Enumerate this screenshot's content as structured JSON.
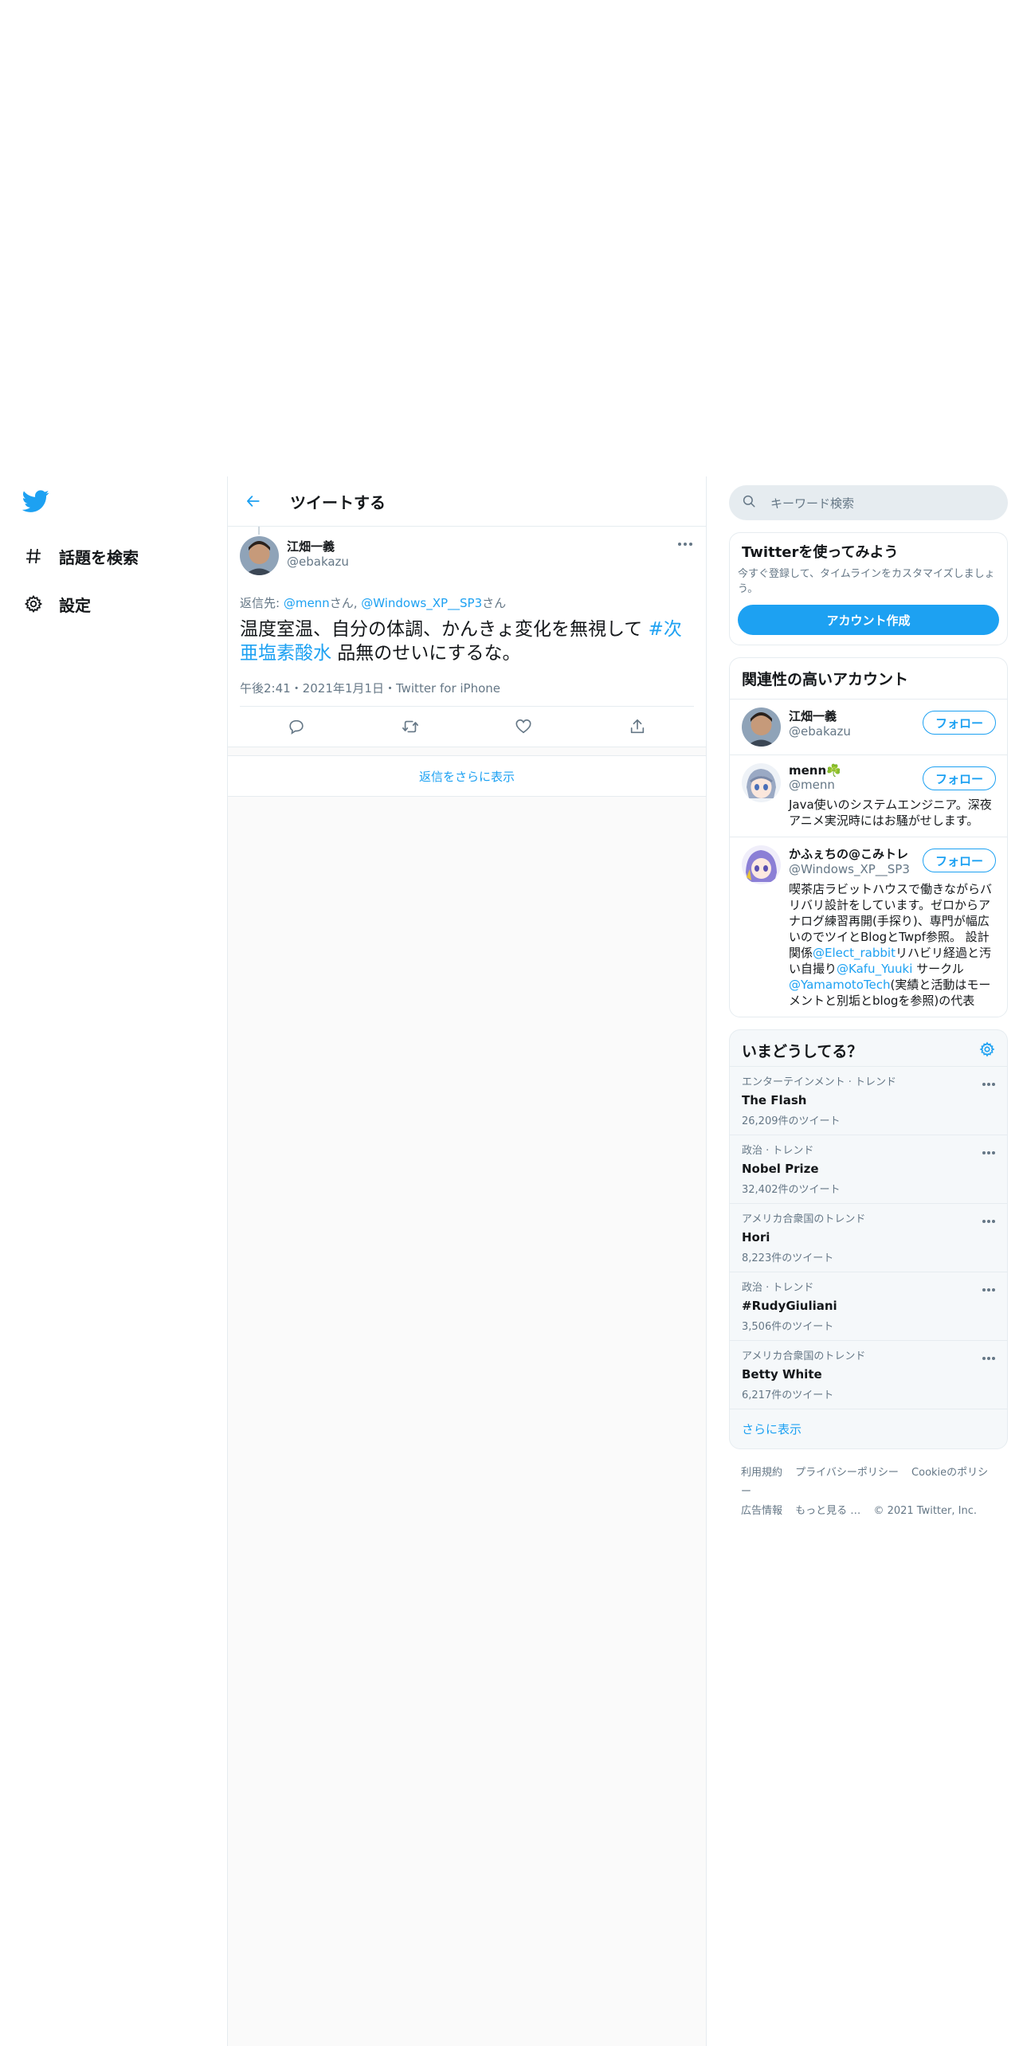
{
  "nav": {
    "items": [
      {
        "label": "話題を検索",
        "icon": "hashtag-icon"
      },
      {
        "label": "設定",
        "icon": "gear-icon"
      }
    ]
  },
  "header": {
    "title": "ツイートする"
  },
  "tweet": {
    "name": "江畑一義",
    "handle": "@ebakazu",
    "reply_prefix": "返信先: ",
    "reply_user1": "@menn",
    "reply_san1": "さん, ",
    "reply_user2": "@Windows_XP__SP3",
    "reply_san2": "さん",
    "text_part1": "温度室温、自分の体調、かんきょ変化を無視して ",
    "hashtag": "#次亜塩素酸水",
    "text_part2": " 品無のせいにするな。",
    "meta": "午後2:41・2021年1月1日・Twitter for iPhone"
  },
  "replies": {
    "show_more": "返信をさらに表示"
  },
  "search": {
    "placeholder": "キーワード検索"
  },
  "promo": {
    "title": "Twitterを使ってみよう",
    "desc": "今すぐ登録して、タイムラインをカスタマイズしましょう。",
    "button": "アカウント作成"
  },
  "related": {
    "title": "関連性の高いアカウント",
    "follow_label": "フォロー",
    "accounts": [
      {
        "name": "江畑一義",
        "handle": "@ebakazu",
        "bio": ""
      },
      {
        "name": "menn☘️",
        "handle": "@menn",
        "bio": "Java使いのシステムエンジニア。深夜アニメ実況時にはお騒がせします。"
      },
      {
        "name": "かふぇちの@こみトレ",
        "handle": "@Windows_XP__SP3",
        "bio_parts": [
          "喫茶店ラビットハウスで働きながらバリバリ設計をしています。ゼロからアナログ練習再開(手探り)、専門が幅広いのでツイとBlogとTwpf参照。 設計関係",
          "@Elect_rabbit",
          "リハビリ経過と汚い自撮り",
          "@Kafu_Yuuki",
          " サークル",
          "@YamamotoTech",
          "(実績と活動はモーメントと別垢とblogを参照)の代表"
        ]
      }
    ]
  },
  "trends": {
    "title": "いまどうしてる？",
    "items": [
      {
        "context": "エンターテインメント · トレンド",
        "title": "The Flash",
        "count": "26,209件のツイート"
      },
      {
        "context": "政治 · トレンド",
        "title": "Nobel Prize",
        "count": "32,402件のツイート"
      },
      {
        "context": "アメリカ合衆国のトレンド",
        "title": "Hori",
        "count": "8,223件のツイート"
      },
      {
        "context": "政治 · トレンド",
        "title": "#RudyGiuliani",
        "count": "3,506件のツイート"
      },
      {
        "context": "アメリカ合衆国のトレンド",
        "title": "Betty White",
        "count": "6,217件のツイート"
      }
    ],
    "show_more": "さらに表示"
  },
  "footer": {
    "links": [
      "利用規約",
      "プライバシーポリシー",
      "Cookieのポリシー",
      "広告情報",
      "もっと見る …"
    ],
    "copyright": "© 2021 Twitter, Inc."
  },
  "colors": {
    "accent": "#1da1f2",
    "text": "#14171a",
    "secondary": "#657786",
    "border": "#e6ecf0"
  }
}
